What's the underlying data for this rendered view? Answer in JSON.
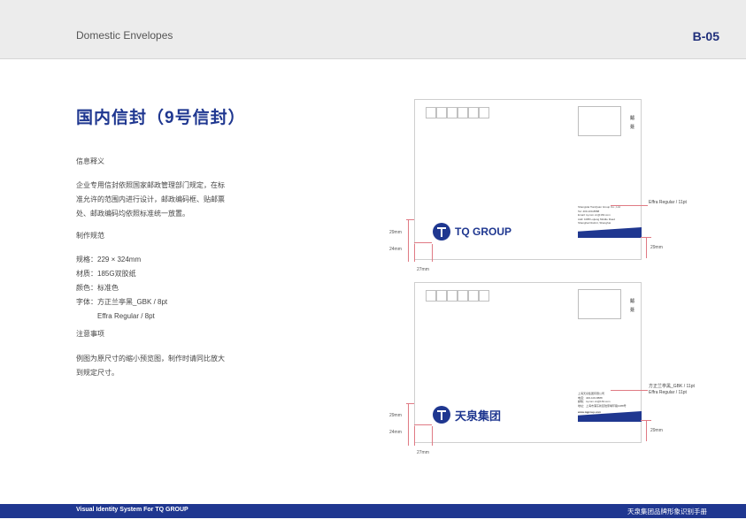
{
  "header": {
    "title": "Domestic Envelopes",
    "code": "B-05"
  },
  "main_title": "国内信封（9号信封）",
  "info_heading": "信息释义",
  "info_body": [
    "企业专用信封依照国家邮政管理部门规定，在标",
    "准允许的范围内进行设计，邮政编码框、贴邮票",
    "处、邮政编码均依照标准统一放置。"
  ],
  "spec_heading": "制作规范",
  "specs": {
    "size": "规格：229 × 324mm",
    "material": "材质：185G双胶纸",
    "color": "颜色：标准色",
    "font": "字体：方正兰亭黑_GBK / 8pt",
    "font2": "Effra Regular / 8pt"
  },
  "note_heading": "注意事项",
  "note_body": [
    "例图为原尺寸的缩小预览图，制作时请同比放大",
    "到规定尺寸。"
  ],
  "stamp_label": [
    "贴",
    "邮",
    "票",
    "处"
  ],
  "envelope_en": {
    "logo_text": "TQ GROUP",
    "address": "ShangHai TianQuan Group Co., Ltd.\nTel: 400-100-8888\nEmail: tq.com.cn@163.com\nAdd: 1088 Lujiang Middle Road\nShanghai District, Shanghai",
    "website": "www.tqgroup.com",
    "callout": "Effra Regular / 11pt"
  },
  "envelope_cn": {
    "logo_text": "天泉集团",
    "address": "上海天泉集团有限公司\n电话：400-100-8888\n邮箱：tq.com.cn@163.com\n地址：上海市浦东新区陆家嘴环路1088号",
    "website": "www.tqgroup.com",
    "callout": [
      "方正兰亭黑_GBK / 11pt",
      "Effra Regular / 11pt"
    ]
  },
  "dims": {
    "top": "29mm",
    "left": "24mm",
    "bottom": "27mm",
    "right": "29mm"
  },
  "footer": {
    "left": "Visual Identity System For TQ GROUP",
    "right": "天泉集团品牌形象识别手册"
  },
  "colors": {
    "brand_blue": "#1f3790"
  }
}
